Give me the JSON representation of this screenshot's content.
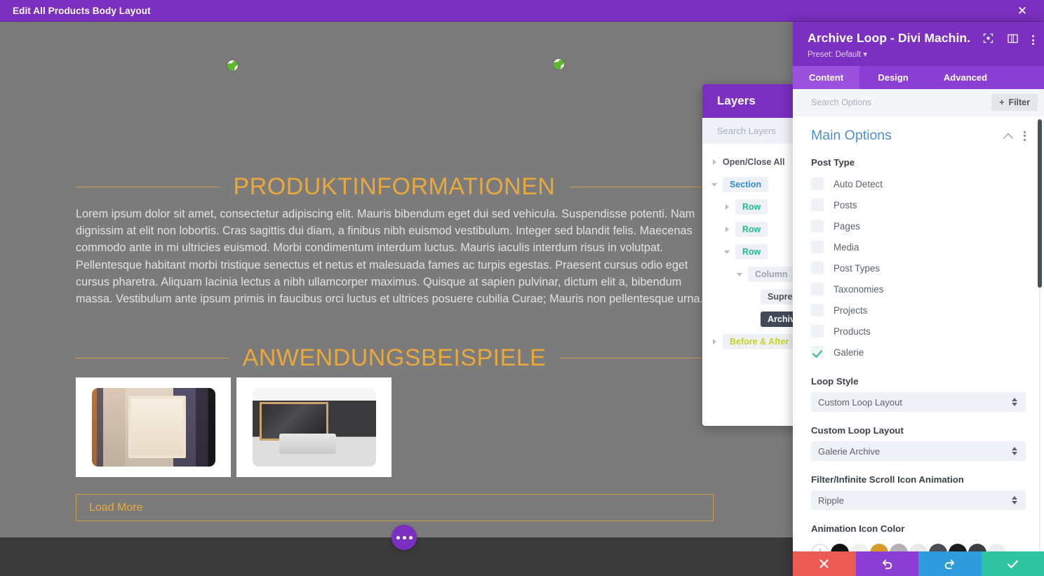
{
  "titlebar": {
    "title": "Edit All Products Body Layout",
    "close_icon": "close-icon"
  },
  "canvas": {
    "sections": [
      {
        "heading": "PRODUKTINFORMATIONEN"
      },
      {
        "heading": "ANWENDUNGSBEISPIELE"
      }
    ],
    "body_text": "Lorem ipsum dolor sit amet, consectetur adipiscing elit. Mauris bibendum eget dui sed vehicula. Suspendisse potenti. Nam dignissim at elit non lobortis. Cras sagittis dui diam, a finibus nibh euismod vestibulum. Integer sed blandit felis. Maecenas commodo ante in mi ultricies euismod. Morbi condimentum interdum luctus. Mauris iaculis interdum risus in volutpat. Pellentesque habitant morbi tristique senectus et netus et malesuada fames ac turpis egestas. Praesent cursus odio eget cursus pharetra. Aliquam lacinia lectus a nibh ullamcorper maximus. Quisque at sapien pulvinar, dictum elit a, bibendum massa. Vestibulum ante ipsum primis in faucibus orci luctus et ultrices posuere cubilia Curae; Mauris non pellentesque urna.",
    "load_more_label": "Load More",
    "accent_color": "#e9a93a",
    "background_color": "#7b7b7b",
    "fab_icon": "more-options-icon"
  },
  "layers_panel": {
    "title": "Layers",
    "search_placeholder": "Search Layers",
    "items": [
      {
        "label": "Open/Close All",
        "level": 0,
        "caret": "right",
        "kind": "openclose",
        "active": false
      },
      {
        "label": "Section",
        "level": 0,
        "caret": "down",
        "kind": "section",
        "active": false
      },
      {
        "label": "Row",
        "level": 1,
        "caret": "right",
        "kind": "row",
        "active": false
      },
      {
        "label": "Row",
        "level": 1,
        "caret": "right",
        "kind": "row",
        "active": false
      },
      {
        "label": "Row",
        "level": 1,
        "caret": "down",
        "kind": "row",
        "active": false
      },
      {
        "label": "Column",
        "level": 2,
        "caret": "down",
        "kind": "column",
        "active": false
      },
      {
        "label": "Supreme",
        "level": 3,
        "caret": "none",
        "kind": "module",
        "active": false
      },
      {
        "label": "Archive L",
        "level": 3,
        "caret": "none",
        "kind": "module",
        "active": true
      },
      {
        "label": "Before & After",
        "level": 0,
        "caret": "right",
        "kind": "ba",
        "active": false
      }
    ]
  },
  "settings_panel": {
    "module_title": "Archive Loop - Divi Machin...",
    "preset_label": "Preset: Default",
    "header_icons": [
      "fullscreen-icon",
      "split-view-icon",
      "kebab-menu-icon"
    ],
    "tabs": [
      {
        "label": "Content",
        "active": true
      },
      {
        "label": "Design",
        "active": false
      },
      {
        "label": "Advanced",
        "active": false
      }
    ],
    "search_placeholder": "Search Options",
    "filter_label": "Filter",
    "section": {
      "title": "Main Options",
      "collapse_icon": "chevron-up-icon",
      "menu_icon": "kebab-menu-icon"
    },
    "post_type": {
      "label": "Post Type",
      "options": [
        {
          "label": "Auto Detect",
          "checked": false
        },
        {
          "label": "Posts",
          "checked": false
        },
        {
          "label": "Pages",
          "checked": false
        },
        {
          "label": "Media",
          "checked": false
        },
        {
          "label": "Post Types",
          "checked": false
        },
        {
          "label": "Taxonomies",
          "checked": false
        },
        {
          "label": "Projects",
          "checked": false
        },
        {
          "label": "Products",
          "checked": false
        },
        {
          "label": "Galerie",
          "checked": true
        }
      ]
    },
    "fields": [
      {
        "label": "Loop Style",
        "value": "Custom Loop Layout"
      },
      {
        "label": "Custom Loop Layout",
        "value": "Galerie Archive"
      },
      {
        "label": "Filter/Infinite Scroll Icon Animation",
        "value": "Ripple"
      }
    ],
    "animation_icon_color": {
      "label": "Animation Icon Color",
      "swatches": [
        "#ffffff",
        "#111111",
        "#f0f0f0",
        "#d89a2b",
        "#b5b0b8",
        "#e9e9ea",
        "#4a4f55",
        "#1d1d20",
        "#3a3d42",
        "#e9eef0"
      ]
    },
    "actions": [
      {
        "name": "cancel",
        "icon": "close-icon"
      },
      {
        "name": "undo",
        "icon": "undo-icon"
      },
      {
        "name": "redo",
        "icon": "redo-icon"
      },
      {
        "name": "save",
        "icon": "check-icon"
      }
    ],
    "accent_color": "#7b30c2"
  }
}
